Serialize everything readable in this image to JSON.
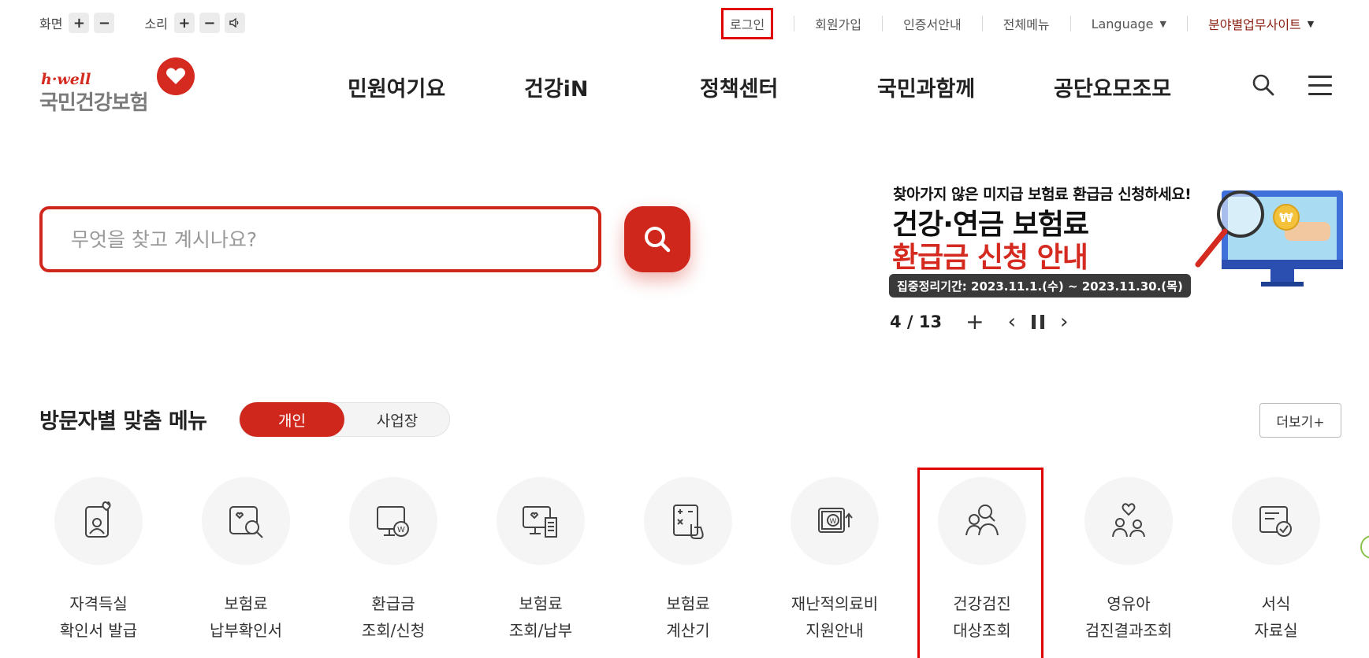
{
  "utility": {
    "screen_label": "화면",
    "sound_label": "소리",
    "plus": "+",
    "minus": "−",
    "links": [
      "로그인",
      "회원가입",
      "인증서안내",
      "전체메뉴",
      "Language",
      "분야별업무사이트"
    ]
  },
  "logo": {
    "brand": "h·well",
    "name": "국민건강보험"
  },
  "gnb": [
    "민원여기요",
    "건강iN",
    "정책센터",
    "국민과함께",
    "공단요모조모"
  ],
  "search": {
    "placeholder": "무엇을 찾고 계시나요?"
  },
  "banner": {
    "subtitle": "찾아가지 않은 미지급 보험료 환급금 신청하세요!",
    "title_line1": "건강·연금 보험료",
    "title_line2": "환급금 신청 안내",
    "period": "집중정리기간: 2023.11.1.(수) ~ 2023.11.30.(목)"
  },
  "slider": {
    "current": "4",
    "total": "13",
    "counter": "4 / 13",
    "plus": "+",
    "prev": "‹",
    "next": "›"
  },
  "visitor_menu": {
    "title": "방문자별 맞춤 메뉴",
    "tabs": [
      "개인",
      "사업장"
    ],
    "more": "더보기+",
    "items": [
      {
        "line1": "자격득실",
        "line2": "확인서 발급",
        "icon": "id-card-heart-icon"
      },
      {
        "line1": "보험료",
        "line2": "납부확인서",
        "icon": "document-search-icon"
      },
      {
        "line1": "환급금",
        "line2": "조회/신청",
        "icon": "monitor-won-icon"
      },
      {
        "line1": "보험료",
        "line2": "조회/납부",
        "icon": "monitor-receipt-icon"
      },
      {
        "line1": "보험료",
        "line2": "계산기",
        "icon": "calculator-icon"
      },
      {
        "line1": "재난적의료비",
        "line2": "지원안내",
        "icon": "wallet-won-icon"
      },
      {
        "line1": "건강검진",
        "line2": "대상조회",
        "icon": "people-search-icon"
      },
      {
        "line1": "영유아",
        "line2": "검진결과조회",
        "icon": "family-heart-icon"
      },
      {
        "line1": "서식",
        "line2": "자료실",
        "icon": "form-check-icon"
      }
    ]
  },
  "colors": {
    "accent": "#d0271d",
    "highlight": "#e00000",
    "field_link": "#8a1f11"
  }
}
